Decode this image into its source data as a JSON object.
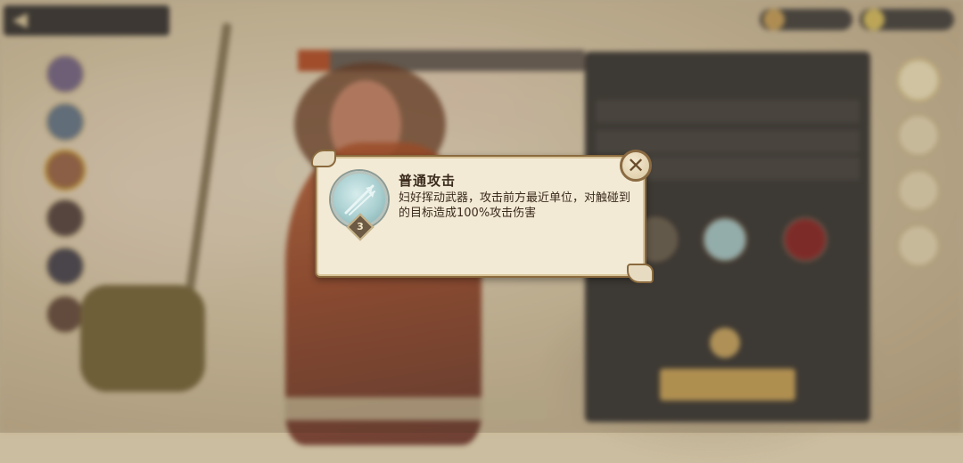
{
  "skill_popup": {
    "name": "普通攻击",
    "description": "妇好挥动武器，攻击前方最近单位，对触碰到的目标造成100%攻击伤害",
    "level": "3",
    "close_icon": "close-x-icon",
    "skill_icon": "crossed-spears-icon"
  },
  "colors": {
    "paper": "#f3ead5",
    "border": "#8a6a3e",
    "medal": "#a9cfd0",
    "text": "#3a2a1c"
  }
}
